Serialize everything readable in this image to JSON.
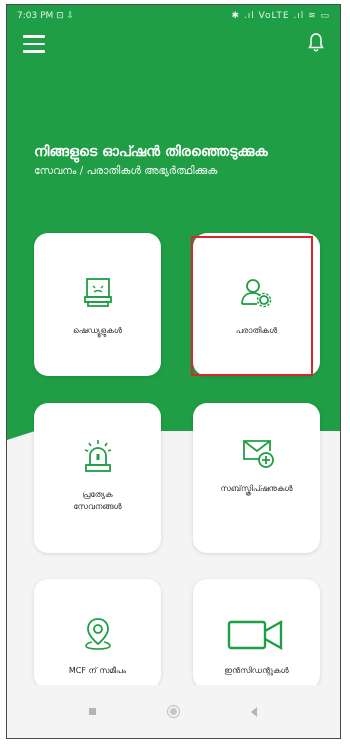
{
  "status_bar": {
    "time": "7:03 PM",
    "left_icons": "⊡ ⇩",
    "right_icons": "✱ .ıl VoLTE .ıl ≋ ▭"
  },
  "header": {
    "title": "നിങ്ങളുടെ ഓപ്ഷൻ തിരഞ്ഞെടുക്കുക",
    "subtitle": "സേവനം / പരാതികൾ അഭ്യർത്ഥിക്കുക"
  },
  "cards": [
    {
      "label": "ഷെഡ്യൂളുകൾ",
      "icon": "schedule-box-icon"
    },
    {
      "label": "പരാതികൾ",
      "icon": "user-settings-icon"
    },
    {
      "label": "പ്രത്യേക സേവനങ്ങൾ",
      "icon": "alarm-light-icon"
    },
    {
      "label": "സബ്‌സ്ക്രിപ്ഷനുകൾ",
      "icon": "mail-plus-icon"
    },
    {
      "label": "MCF ന് സമീപം",
      "icon": "location-pin-icon"
    },
    {
      "label": "ഇൻസിഡന്റുകൾ",
      "icon": "video-camera-icon"
    }
  ],
  "colors": {
    "brand_green": "#1f9e45",
    "highlight_red": "#d9262d"
  }
}
